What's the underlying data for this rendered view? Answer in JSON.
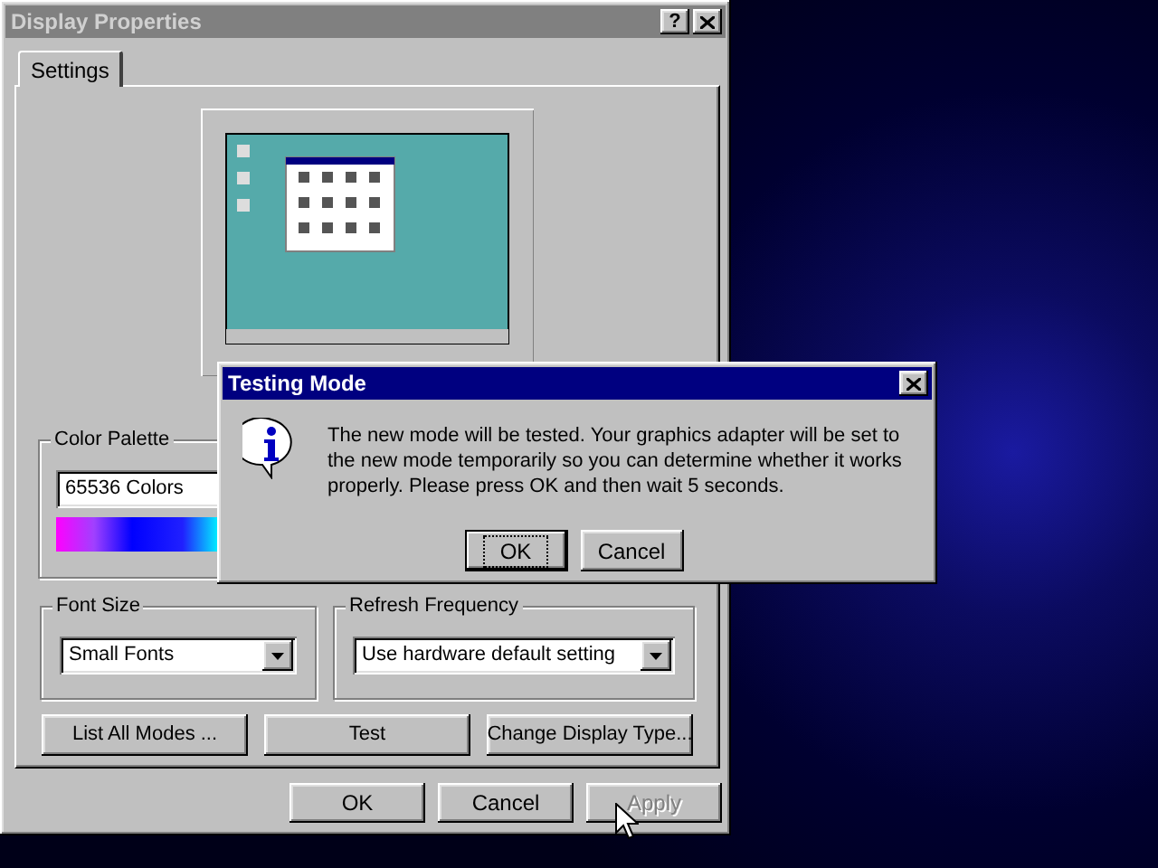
{
  "window": {
    "title": "Display Properties",
    "active": false,
    "help_button": "?"
  },
  "tabs": [
    {
      "label": "Settings",
      "selected": true
    }
  ],
  "color_palette": {
    "label": "Color Palette",
    "value": "65536 Colors"
  },
  "font_size": {
    "label": "Font Size",
    "value": "Small Fonts"
  },
  "refresh_frequency": {
    "label": "Refresh Frequency",
    "value": "Use hardware default setting"
  },
  "actions": [
    {
      "label": "List All Modes ..."
    },
    {
      "label": "Test"
    },
    {
      "label": "Change Display Type..."
    }
  ],
  "buttons": [
    {
      "label": "OK",
      "disabled": false
    },
    {
      "label": "Cancel",
      "disabled": false
    },
    {
      "label": "Apply",
      "disabled": true
    }
  ],
  "dialog": {
    "title": "Testing Mode",
    "active": true,
    "message": "The new mode will be tested. Your graphics adapter will be set to the new mode temporarily so you can determine whether it works properly. Please press OK and then wait 5 seconds.",
    "buttons": [
      {
        "label": "OK",
        "focused": true
      },
      {
        "label": "Cancel",
        "focused": false
      }
    ]
  }
}
